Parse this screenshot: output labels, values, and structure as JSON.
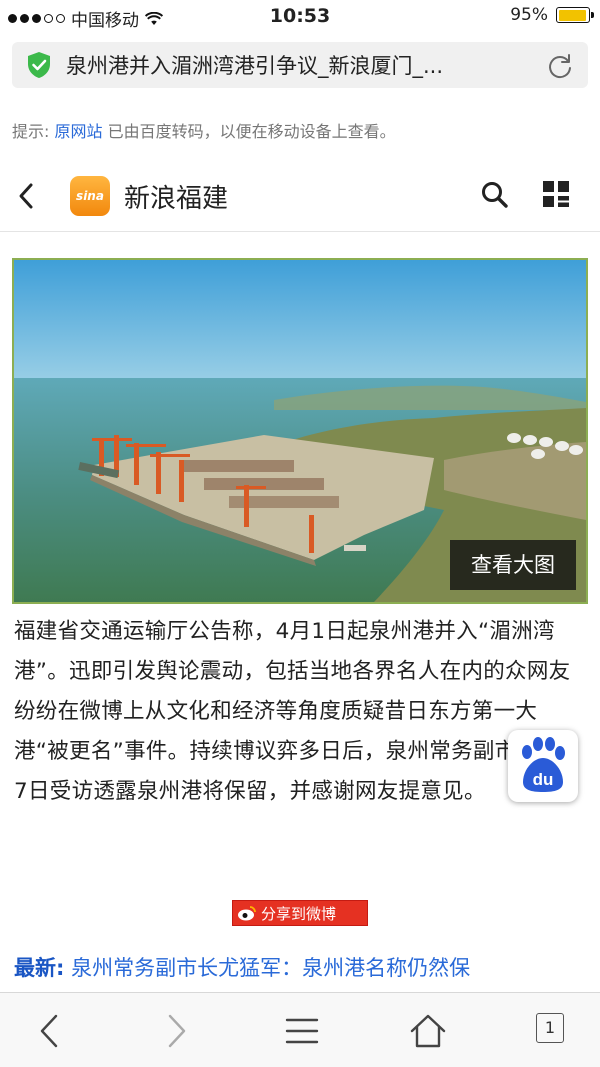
{
  "status_bar": {
    "carrier": "中国移动",
    "time": "10:53",
    "battery": "95%",
    "battery_level": 0.95
  },
  "address_bar": {
    "title": "泉州港并入湄洲湾港引争议_新浪厦门_..."
  },
  "hint": {
    "prefix": "提示:",
    "link": "原网站",
    "text": "已由百度转码，以便在移动设备上查看。"
  },
  "header": {
    "logo_text": "sina",
    "brand": "新浪福建"
  },
  "image": {
    "view_large": "查看大图"
  },
  "article": {
    "body": "福建省交通运输厅公告称，4月1日起泉州港并入“湄洲湾港”。迅即引发舆论震动，包括当地各界名人在内的众网友纷纷在微博上从文化和经济等角度质疑昔日东方第一大港“被更名”事件。持续博议弈多日后，泉州常务副市长4月7日受访透露泉州港将保留，并感谢网友提意见。",
    "share_label": "分享到微博",
    "latest_label": "最新:",
    "latest_text": "泉州常务副市长尤猛军：泉州港名称仍然保"
  },
  "floating": {
    "badge_text": "du"
  },
  "toolbar": {
    "tab_count": "1"
  },
  "colors": {
    "link": "#2a6ad8",
    "sina_orange": "#f2880d",
    "share_red": "#e53122",
    "secure_green": "#3cb94a",
    "baidu_blue": "#2a5bd7"
  },
  "icons": [
    "wifi-icon",
    "shield-check-icon",
    "reload-icon",
    "back-icon",
    "search-icon",
    "grid-menu-icon",
    "weibo-icon",
    "baidu-paw-icon",
    "nav-back-icon",
    "nav-forward-icon",
    "menu-icon",
    "home-icon"
  ]
}
